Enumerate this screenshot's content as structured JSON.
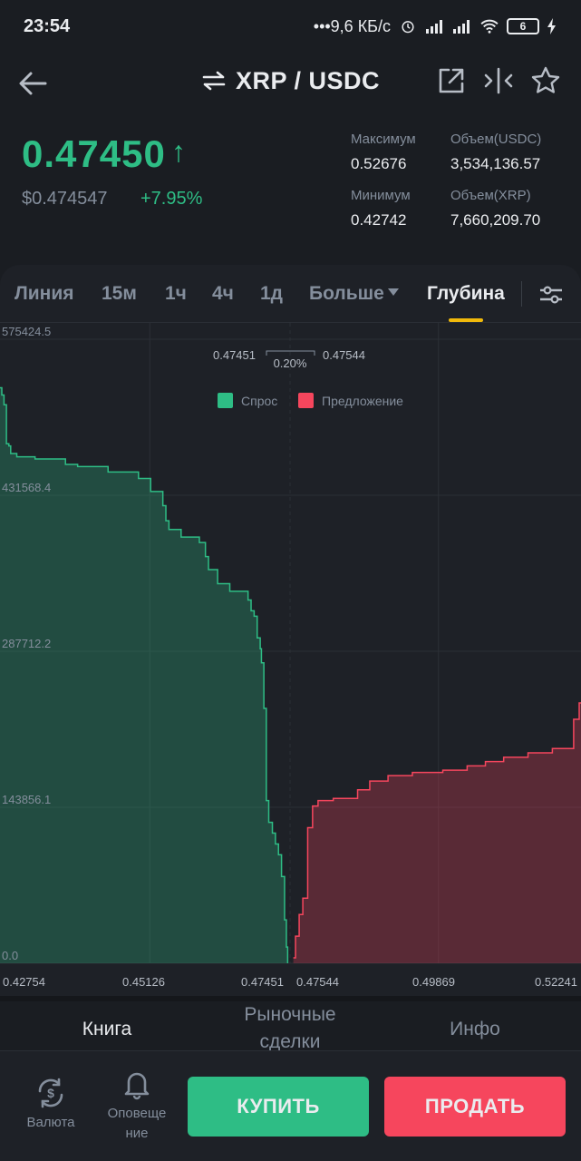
{
  "status_bar": {
    "time": "23:54",
    "network_speed": "•••9,6 КБ/с",
    "battery": "6"
  },
  "header": {
    "pair": "XRP / USDC",
    "icons": [
      "back-arrow-icon",
      "swap-icon",
      "external-link-icon",
      "compare-icon",
      "star-icon"
    ]
  },
  "ticker": {
    "price": "0.47450",
    "price_arrow": "↑",
    "usd_price": "$0.474547",
    "change": "+7.95%",
    "high_label": "Максимум",
    "high": "0.52676",
    "low_label": "Минимум",
    "low": "0.42742",
    "vol_quote_label": "Объем(USDC)",
    "vol_quote": "3,534,136.57",
    "vol_base_label": "Объем(XRP)",
    "vol_base": "7,660,209.70"
  },
  "chart_tabs": {
    "items": [
      "Линия",
      "15м",
      "1ч",
      "4ч",
      "1д",
      "Больше",
      "Глубина"
    ],
    "active": "Глубина"
  },
  "chart_data": {
    "type": "area",
    "y_ticks": [
      "575424.5",
      "431568.4",
      "287712.2",
      "143856.1",
      "0.0"
    ],
    "x_ticks": [
      "0.42754",
      "0.45126",
      "0.47451",
      "0.47544",
      "0.49869",
      "0.52241"
    ],
    "spread": {
      "bid": "0.47451",
      "ask": "0.47544",
      "pct": "0.20%"
    },
    "legend": [
      {
        "name": "Спрос",
        "color": "#2ebd85"
      },
      {
        "name": "Предложение",
        "color": "#f6465d"
      }
    ],
    "ylim": [
      0,
      575424.5
    ],
    "xlim": [
      0.42754,
      0.52241
    ],
    "series": [
      {
        "name": "Спрос",
        "x": [
          0.42754,
          0.4279,
          0.4283,
          0.4287,
          0.429,
          0.43,
          0.433,
          0.438,
          0.44,
          0.445,
          0.45,
          0.452,
          0.454,
          0.4545,
          0.455,
          0.457,
          0.46,
          0.461,
          0.4615,
          0.463,
          0.465,
          0.468,
          0.4685,
          0.469,
          0.4695,
          0.47,
          0.4702,
          0.4706,
          0.471,
          0.4714,
          0.472,
          0.4725,
          0.473,
          0.4735,
          0.474,
          0.4743,
          0.47451
        ],
        "y": [
          524000,
          515000,
          479000,
          477000,
          470000,
          467000,
          465000,
          460000,
          458000,
          453000,
          447000,
          435000,
          422000,
          408000,
          400000,
          393000,
          388000,
          375000,
          363000,
          350000,
          343000,
          335000,
          325000,
          320000,
          300000,
          290000,
          277000,
          235000,
          150000,
          130000,
          120000,
          110000,
          100000,
          80000,
          40000,
          15000,
          0
        ]
      },
      {
        "name": "Предложение",
        "x": [
          0.47544,
          0.4758,
          0.4764,
          0.477,
          0.4778,
          0.4786,
          0.4795,
          0.482,
          0.486,
          0.488,
          0.491,
          0.495,
          0.5,
          0.504,
          0.507,
          0.51,
          0.514,
          0.518,
          0.5215,
          0.52241
        ],
        "y": [
          5000,
          25000,
          45000,
          60000,
          125000,
          145000,
          150000,
          152000,
          160000,
          168000,
          173000,
          176000,
          178000,
          182000,
          186000,
          190000,
          194000,
          198000,
          225000,
          240000
        ]
      }
    ]
  },
  "bottom_tabs": {
    "book": "Книга",
    "trades_line1": "Рыночные",
    "trades_line2": "сделки",
    "info": "Инфо"
  },
  "actions": {
    "currency_line1": "Валюта",
    "alerts_line1": "Оповеще",
    "alerts_line2": "ние",
    "buy": "КУПИТЬ",
    "sell": "ПРОДАТЬ"
  }
}
